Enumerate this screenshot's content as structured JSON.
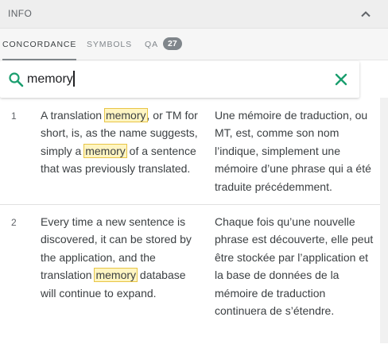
{
  "panel": {
    "title": "INFO",
    "collapse_icon": "chevron-up-icon"
  },
  "tabs": [
    {
      "label": "CONCORDANCE",
      "active": true
    },
    {
      "label": "SYMBOLS",
      "active": false
    },
    {
      "label": "QA",
      "active": false,
      "badge": "27"
    }
  ],
  "search": {
    "value": "memory",
    "search_icon": "search-icon",
    "clear_icon": "close-icon"
  },
  "results": [
    {
      "number": "1",
      "source": [
        "A translation ",
        "memory",
        ", or TM for short, is, as the name suggests, simply a ",
        "memory",
        " of a sentence that was previously translated."
      ],
      "target": "Une mémoire de traduction, ou MT, est, comme son nom l’indique, simplement une mémoire d’une phrase qui a été traduite précédemment."
    },
    {
      "number": "2",
      "source": [
        "Every time a new sentence is discovered, it can be stored by the application, and the translation ",
        "memory",
        " database will continue to expand."
      ],
      "target": "Chaque fois qu’une nouvelle phrase est découverte, elle peut être stockée par l’application et la base de données de la mémoire de traduction continuera de s’étendre."
    }
  ],
  "colors": {
    "accent": "#1a9e6e",
    "highlight": "#fff5c2",
    "highlight_border": "#e8c547"
  }
}
